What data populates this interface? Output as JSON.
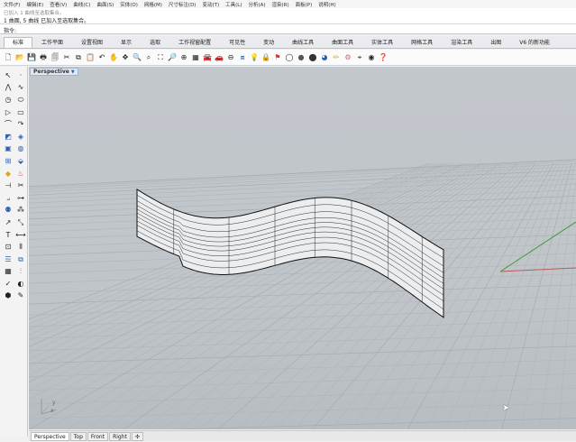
{
  "menu": {
    "items": [
      "文件(F)",
      "编辑(E)",
      "查看(V)",
      "曲线(C)",
      "曲面(S)",
      "实体(O)",
      "网格(M)",
      "尺寸标注(D)",
      "变动(T)",
      "工具(L)",
      "分析(A)",
      "渲染(R)",
      "面板(P)",
      "说明(H)"
    ]
  },
  "command": {
    "history_prev": "已加入 1 曲线至选取集合。",
    "history_last": "1 曲面, 5 曲线 已加入至选取集合。",
    "prompt": "指令:"
  },
  "ribbon": {
    "tabs": [
      "标准",
      "工作平面",
      "设置视图",
      "显示",
      "选取",
      "工作视窗配置",
      "可见性",
      "变动",
      "曲线工具",
      "曲面工具",
      "实体工具",
      "网格工具",
      "渲染工具",
      "出图",
      "V6 的新功能"
    ],
    "active_tab": "标准"
  },
  "toolbar_icons": [
    "new-file-icon",
    "open-file-icon",
    "save-icon",
    "print-icon",
    "import-icon",
    "cut-icon",
    "copy-icon",
    "paste-icon",
    "undo-icon",
    "pan-icon",
    "rotate-view-icon",
    "zoom-icon",
    "zoom-window-icon",
    "zoom-extents-icon",
    "zoom-selected-icon",
    "zoom-all-icon",
    "grid-icon",
    "car-icon",
    "car-alt-icon",
    "select-by-color-icon",
    "layer-icon",
    "light-icon",
    "lock-icon",
    "properties-icon",
    "wireframe-icon",
    "shaded-icon",
    "rendered-icon",
    "render-icon",
    "settings-icon",
    "options-icon",
    "snap-icon",
    "osnap-icon",
    "help-icon"
  ],
  "viewport": {
    "label": "Perspective",
    "axis_x": "x",
    "axis_y": "y"
  },
  "view_tabs": {
    "items": [
      "Perspective",
      "Top",
      "Front",
      "Right"
    ],
    "active": "Perspective",
    "add_symbol": "✣"
  },
  "colors": {
    "viewport_bg": "#c0c5ca",
    "grid_minor": "#b0b5ba",
    "grid_major": "#a4a9ae",
    "axis_green": "#3a9b3a",
    "axis_red": "#b85a5a",
    "surface": "#ffffff",
    "accent": "#2d5fb0"
  }
}
